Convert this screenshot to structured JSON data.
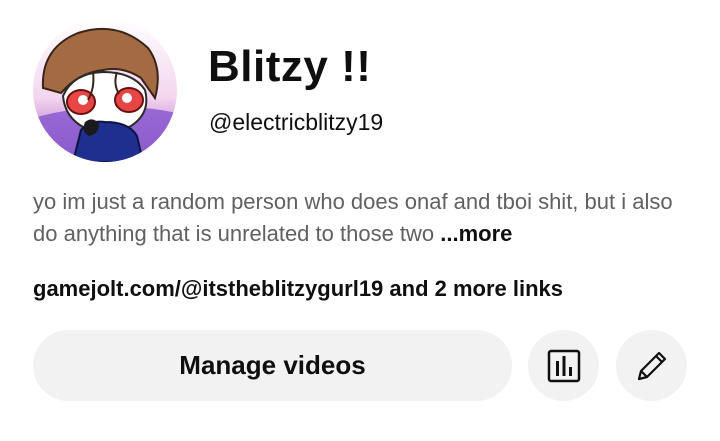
{
  "profile": {
    "avatar_icon": "character-avatar-icon",
    "name": "Blitzy !!",
    "handle": "@electricblitzy19",
    "description": "yo im just a random person who does onaf and tboi shit, but i also do anything that is unrelated to those two",
    "more_label": "...more",
    "links_text": "gamejolt.com/@itstheblitzygurl19 and 2 more links"
  },
  "actions": {
    "manage_videos_label": "Manage videos",
    "analytics_icon": "analytics-icon",
    "edit_icon": "pencil-icon"
  },
  "colors": {
    "button_bg": "#f2f2f2",
    "primary_text": "#0f0f0f",
    "secondary_text": "#606060"
  }
}
